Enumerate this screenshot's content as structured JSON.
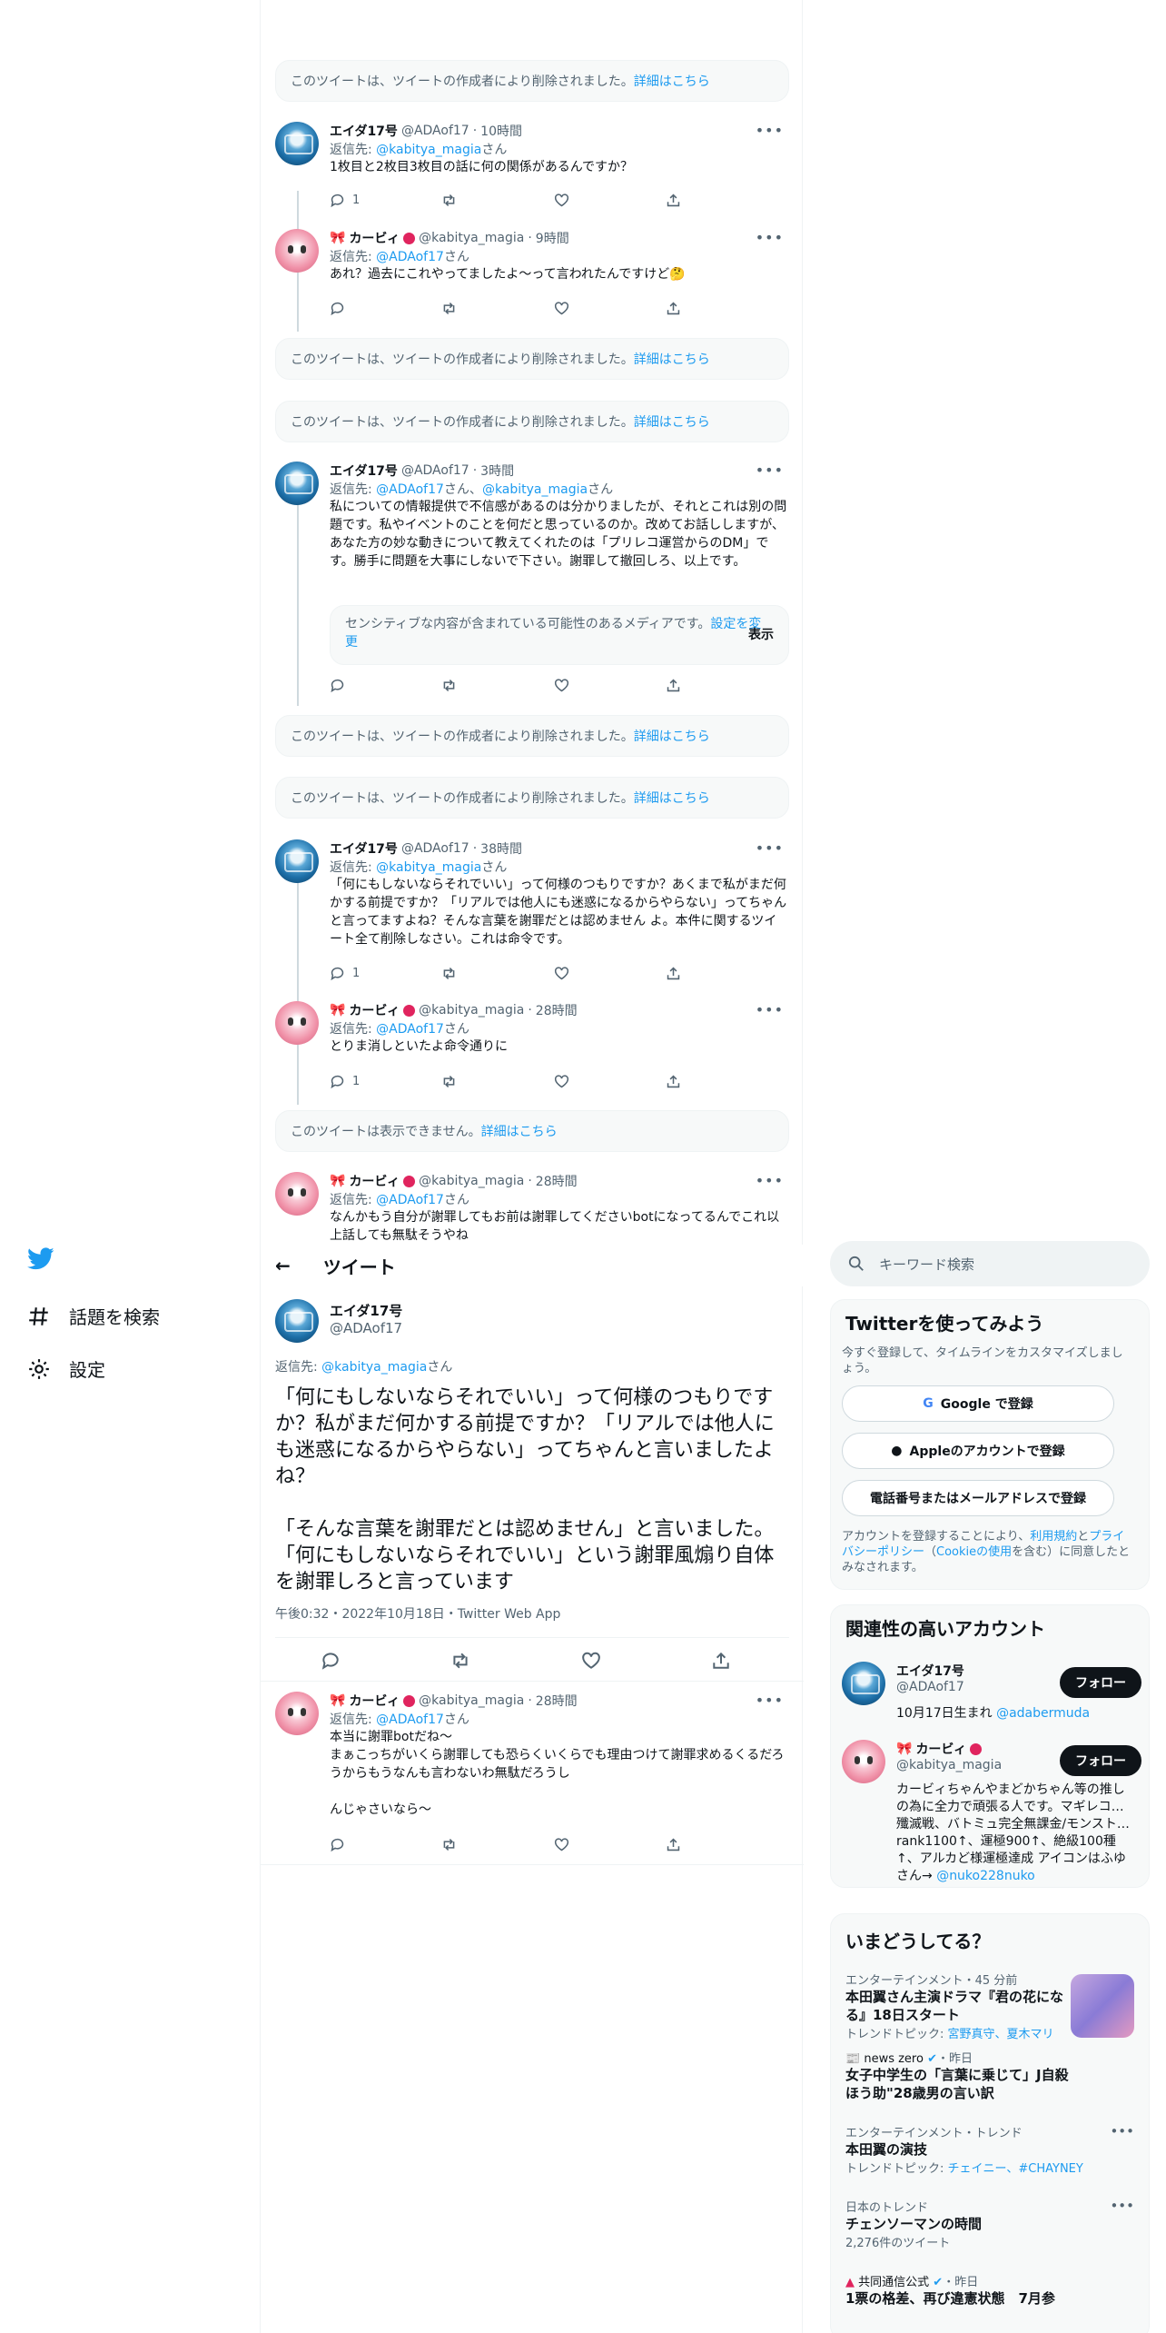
{
  "nav": {
    "explore_label": "話題を検索",
    "settings_label": "設定"
  },
  "deleted_text": "このツイートは、ツイートの作成者により削除されました。",
  "details_link": "詳細はこちら",
  "unavailable_text": "このツイートは表示できません。",
  "reply_to_prefix": "返信先: ",
  "reply_to_suffix": "さん",
  "thread": [
    {
      "name": "エイダ17号",
      "handle": "@ADAof17",
      "time": "10時間",
      "reply_to": "@kabitya_magia",
      "text": "1枚目と2枚目3枚目の話に何の関係があるんですか？",
      "reply_count": "1"
    },
    {
      "name": "カービィ",
      "handle": "@kabitya_magia",
      "time": "9時間",
      "reply_to": "@ADAof17",
      "text": "あれ？過去にこれやってましたよ〜って言われたんですけど🤔",
      "reply_count": ""
    },
    {
      "name": "エイダ17号",
      "handle": "@ADAof17",
      "time": "3時間",
      "reply_to": "@ADAof17",
      "reply_to_2": "@kabitya_magia",
      "text": "私についての情報提供で不信感があるのは分かりましたが、それとこれは別の問題です。私やイベントのことを何だと思っているのか。改めてお話ししますが、あなた方の妙な動きについて教えてくれたのは「プリレコ運営からのDM」です。勝手に問題を大事にしないで下さい。謝罪して撤回しろ、以上です。",
      "reply_count": ""
    },
    {
      "name": "エイダ17号",
      "handle": "@ADAof17",
      "time": "38時間",
      "reply_to": "@kabitya_magia",
      "text": "「何にもしないならそれでいい」って何様のつもりですか？あくまで私がまだ何かする前提ですか？「リアルでは他人にも迷惑になるからやらない」ってちゃんと言ってますよね？そんな言葉を謝罪だとは認めません よ。本件に関するツイート全て削除しなさい。これは命令です。",
      "reply_count": "1"
    },
    {
      "name": "カービィ",
      "handle": "@kabitya_magia",
      "time": "28時間",
      "reply_to": "@ADAof17",
      "text": "とりま消しといたよ命令通りに",
      "reply_count": "1"
    },
    {
      "name": "カービィ",
      "handle": "@kabitya_magia",
      "time": "28時間",
      "reply_to": "@ADAof17",
      "text": "なんかもう自分が謝罪してもお前は謝罪してくださいbotになってるんでこれ以上話しても無駄そうやね",
      "reply_count": ""
    }
  ],
  "sensitive": {
    "text": "センシティブな内容が含まれている可能性のあるメディアです。",
    "change_link": "設定を変更",
    "show_button": "表示"
  },
  "main": {
    "header_title": "ツイート",
    "name": "エイダ17号",
    "handle": "@ADAof17",
    "reply_to": "@kabitya_magia",
    "text": "「何にもしないならそれでいい」って何様のつもりですか？私がまだ何かする前提ですか？「リアルでは他人にも迷惑になるからやらない」ってちゃんと言いましたよね？\n\n「そんな言葉を謝罪だとは認めません」と言いました。「何にもしないならそれでいい」という謝罪風煽り自体を謝罪しろと言っています",
    "meta": "午後0:32・2022年10月18日・Twitter Web App"
  },
  "last_reply": {
    "name": "カービィ",
    "handle": "@kabitya_magia",
    "time": "28時間",
    "reply_to": "@ADAof17",
    "text": "本当に謝罪botだね〜\nまぁこっちがいくら謝罪しても恐らくいくらでも理由つけて謝罪求めるくるだろうからもうなんも言わないわ無駄だろうし\n\nんじゃさいなら〜"
  },
  "right": {
    "search_placeholder": "キーワード検索",
    "signup": {
      "title": "Twitterを使ってみよう",
      "desc": "今すぐ登録して、タイムラインをカスタマイズしましょう。",
      "google": "Google で登録",
      "apple": "Appleのアカウントで登録",
      "phone": "電話番号またはメールアドレスで登録",
      "legal_prefix": "アカウントを登録することにより、",
      "terms": "利用規約",
      "and": "と",
      "privacy": "プライバシーポリシー",
      "cookie_open": "（",
      "cookie": "Cookieの使用",
      "legal_suffix": "を含む）に同意したとみなされます。"
    },
    "related": {
      "title": "関連性の高いアカウント",
      "follow": "フォロー",
      "accounts": [
        {
          "name": "エイダ17号",
          "handle": "@ADAof17",
          "bio": "10月17日生まれ ",
          "bio_link": "@adabermuda"
        },
        {
          "name": "カービィ",
          "handle": "@kabitya_magia",
          "bio": "カービィちゃんやまどかちゃん等の推しの為に全力で頑張る人です。マギレコ…殲滅戦、バトミュ完全無課金/モンスト…rank1100↑、運極900↑、絶級100種↑、アルカど様運極達成 アイコンはふゆさん→ ",
          "bio_link": "@nuko228nuko"
        }
      ]
    },
    "trends": {
      "title": "いまどうしてる？",
      "items": [
        {
          "meta": "エンターテインメント・45 分前",
          "title": "本田翼さん主演ドラマ『君の花になる』18日スタート",
          "sub_prefix": "トレンドトピック: ",
          "sub_link": "宮野真守、夏木マリ"
        },
        {
          "meta_source": "news zero",
          "meta_time": "・昨日",
          "title": "女子中学生の「言葉に乗じて」J自殺ほう助\"28歳男の言い訳"
        },
        {
          "meta": "エンターテインメント・トレンド",
          "title": "本田翼の演技",
          "sub_prefix": "トレンドトピック: ",
          "sub_link": "チェイニー、#CHAYNEY"
        },
        {
          "meta": "日本のトレンド",
          "title": "チェンソーマンの時間",
          "sub": "2,276件のツイート"
        },
        {
          "meta_source": "共同通信公式",
          "meta_time": "・昨日",
          "title": "1票の格差、再び違憲状態　7月参"
        }
      ]
    }
  }
}
